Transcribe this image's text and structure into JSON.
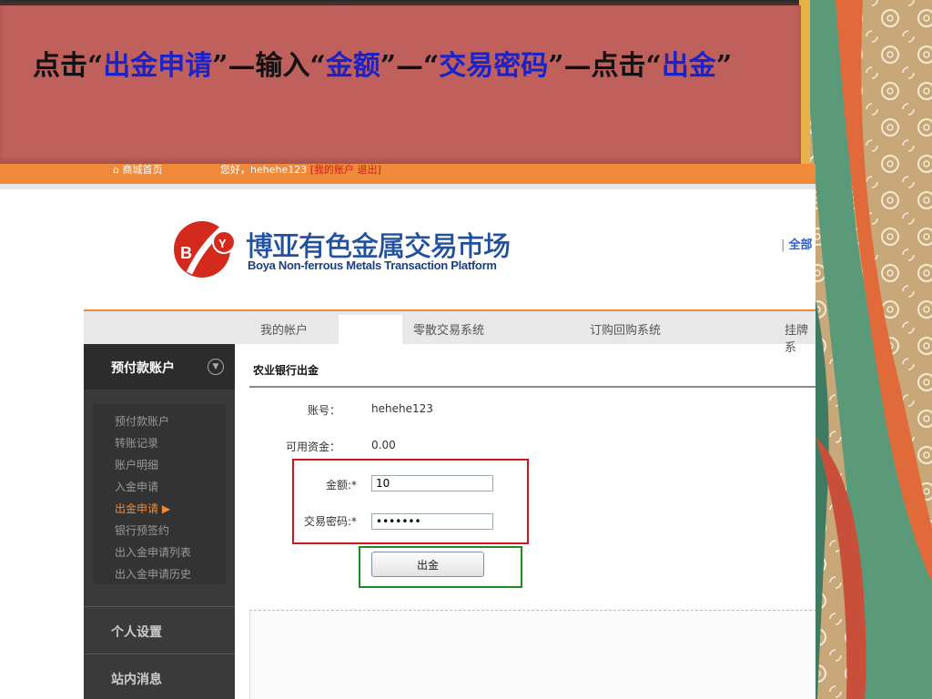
{
  "banner": {
    "t1": "点击“",
    "h1": "出金申请",
    "t2": "”—输入“",
    "h2": "金额",
    "t3": "”—“",
    "h3": "交易密码",
    "t4": "”—点击“",
    "h4": "出金",
    "t5": "”"
  },
  "topbar": {
    "home": "商城首页",
    "greeting": "您好，hehehe123",
    "links": "[我的账户 退出]"
  },
  "logo": {
    "mark": "BY",
    "cn": "博亚有色金属交易市场",
    "en": "Boya Non-ferrous Metals Transaction Platform"
  },
  "top_right": {
    "sep": "|",
    "text": "全部"
  },
  "nav": [
    "我的帐户",
    "零散交易系统",
    "订购回购系统",
    "挂牌系"
  ],
  "sidebar": {
    "header": "预付款账户",
    "items": [
      "预付款账户",
      "转账记录",
      "账户明细",
      "入金申请",
      "出金申请 ▶",
      "银行预签约",
      "出入金申请列表",
      "出入金申请历史"
    ],
    "sections": [
      "个人设置",
      "站内消息"
    ]
  },
  "form": {
    "title": "农业银行出金",
    "account_label": "账号：",
    "account_value": "hehehe123",
    "funds_label": "可用资金：",
    "funds_value": "0.00",
    "amount_label": "金额:*",
    "amount_value": "10",
    "password_label": "交易密码:*",
    "password_value": "•••••••",
    "submit": "出金"
  },
  "colors": {
    "banner": "#c0605c",
    "highlight": "#1a22c8",
    "orange": "#f08a3a",
    "red_box": "#d01616",
    "green_box": "#1e8a1e"
  }
}
